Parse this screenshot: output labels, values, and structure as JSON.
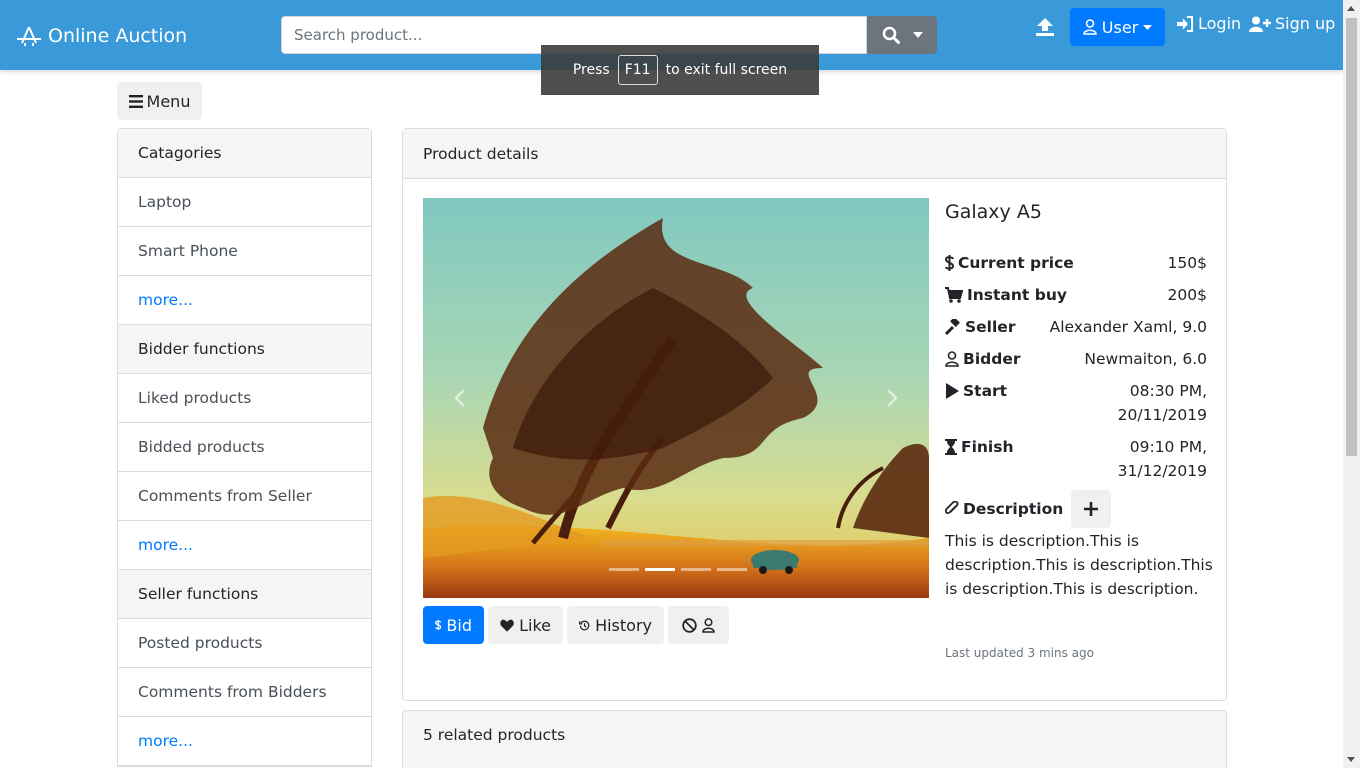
{
  "navbar": {
    "brand": "Online Auction",
    "search_placeholder": "Search product...",
    "user_label": "User",
    "login_label": "Login",
    "signup_label": "Sign up"
  },
  "fullscreen_notice": {
    "press": "Press",
    "key": "F11",
    "suffix": "to exit full screen"
  },
  "menu_button": "Menu",
  "sidebar": {
    "items": [
      {
        "label": "Catagories",
        "type": "header"
      },
      {
        "label": "Laptop",
        "type": "item"
      },
      {
        "label": "Smart Phone",
        "type": "item"
      },
      {
        "label": "more...",
        "type": "more"
      },
      {
        "label": "Bidder functions",
        "type": "header"
      },
      {
        "label": "Liked products",
        "type": "item"
      },
      {
        "label": "Bidded products",
        "type": "item"
      },
      {
        "label": "Comments from Seller",
        "type": "item"
      },
      {
        "label": "more...",
        "type": "more"
      },
      {
        "label": "Seller functions",
        "type": "header"
      },
      {
        "label": "Posted products",
        "type": "item"
      },
      {
        "label": "Comments from Bidders",
        "type": "item"
      },
      {
        "label": "more...",
        "type": "more"
      }
    ]
  },
  "product": {
    "card_title": "Product details",
    "name": "Galaxy A5",
    "current_price_label": "Current price",
    "current_price": "150$",
    "instant_buy_label": "Instant buy",
    "instant_buy": "200$",
    "seller_label": "Seller",
    "seller": "Alexander Xaml, 9.0",
    "bidder_label": "Bidder",
    "bidder": "Newmaiton, 6.0",
    "start_label": "Start",
    "start_time": "08:30 PM,",
    "start_date": "20/11/2019",
    "finish_label": "Finish",
    "finish_time": "09:10 PM,",
    "finish_date": "31/12/2019",
    "description_label": "Description",
    "description": "This is description.This is description.This is description.This is description.This is description.",
    "last_updated": "Last updated 3 mins ago",
    "carousel_slides": 4,
    "carousel_active": 2
  },
  "actions": {
    "bid": "Bid",
    "like": "Like",
    "history": "History"
  },
  "related": {
    "title": "5 related products"
  },
  "colors": {
    "navbar": "#3a9ad9",
    "primary": "#007bff",
    "link": "#007bff"
  }
}
